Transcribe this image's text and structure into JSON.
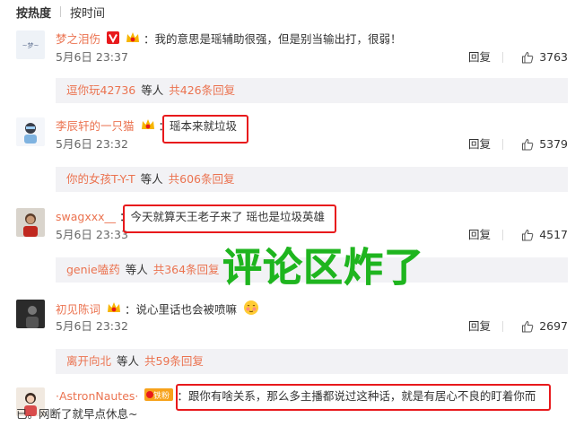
{
  "sort": {
    "active": "按热度",
    "other": "按时间"
  },
  "comments": [
    {
      "user": "梦之泪伤",
      "text": "：我的意思是瑶辅助很强，但是别当输出打，很弱！",
      "time": "5月6日 23:37",
      "reply": "回复",
      "likes": "3763",
      "sub": {
        "user": "逗你玩42736",
        "mid": "等人",
        "count": "共426条回复"
      }
    },
    {
      "user": "李辰轩的一只猫",
      "text": "瑶本来就垃圾",
      "time": "5月6日 23:32",
      "reply": "回复",
      "likes": "5379",
      "sub": {
        "user": "你的女孩T-Y-T",
        "mid": "等人",
        "count": "共606条回复"
      }
    },
    {
      "user": "swagxxx__",
      "text": "今天就算天王老子来了 瑶也是垃圾英雄",
      "time": "5月6日 23:33",
      "reply": "回复",
      "likes": "4517",
      "sub": {
        "user": "genie嗑药",
        "mid": "等人",
        "count": "共364条回复"
      }
    },
    {
      "user": "初见陈词",
      "text": "：说心里话也会被喷嘛",
      "time": "5月6日 23:32",
      "reply": "回复",
      "likes": "2697",
      "sub": {
        "user": "离开向北",
        "mid": "等人",
        "count": "共59条回复"
      }
    },
    {
      "user": "·AstronNautes·",
      "badge": "铁粉",
      "text": "跟你有啥关系，那么多主播都说过这种话，就是有居心不良的盯着你而",
      "text2": "已。网断了就早点休息~"
    }
  ],
  "overlay": "评论区炸了",
  "colors": {
    "username": "#eb7350",
    "highlight_box": "#e8191c",
    "overlay_text": "#1fb51f",
    "subbar_bg": "#f2f2f5"
  }
}
